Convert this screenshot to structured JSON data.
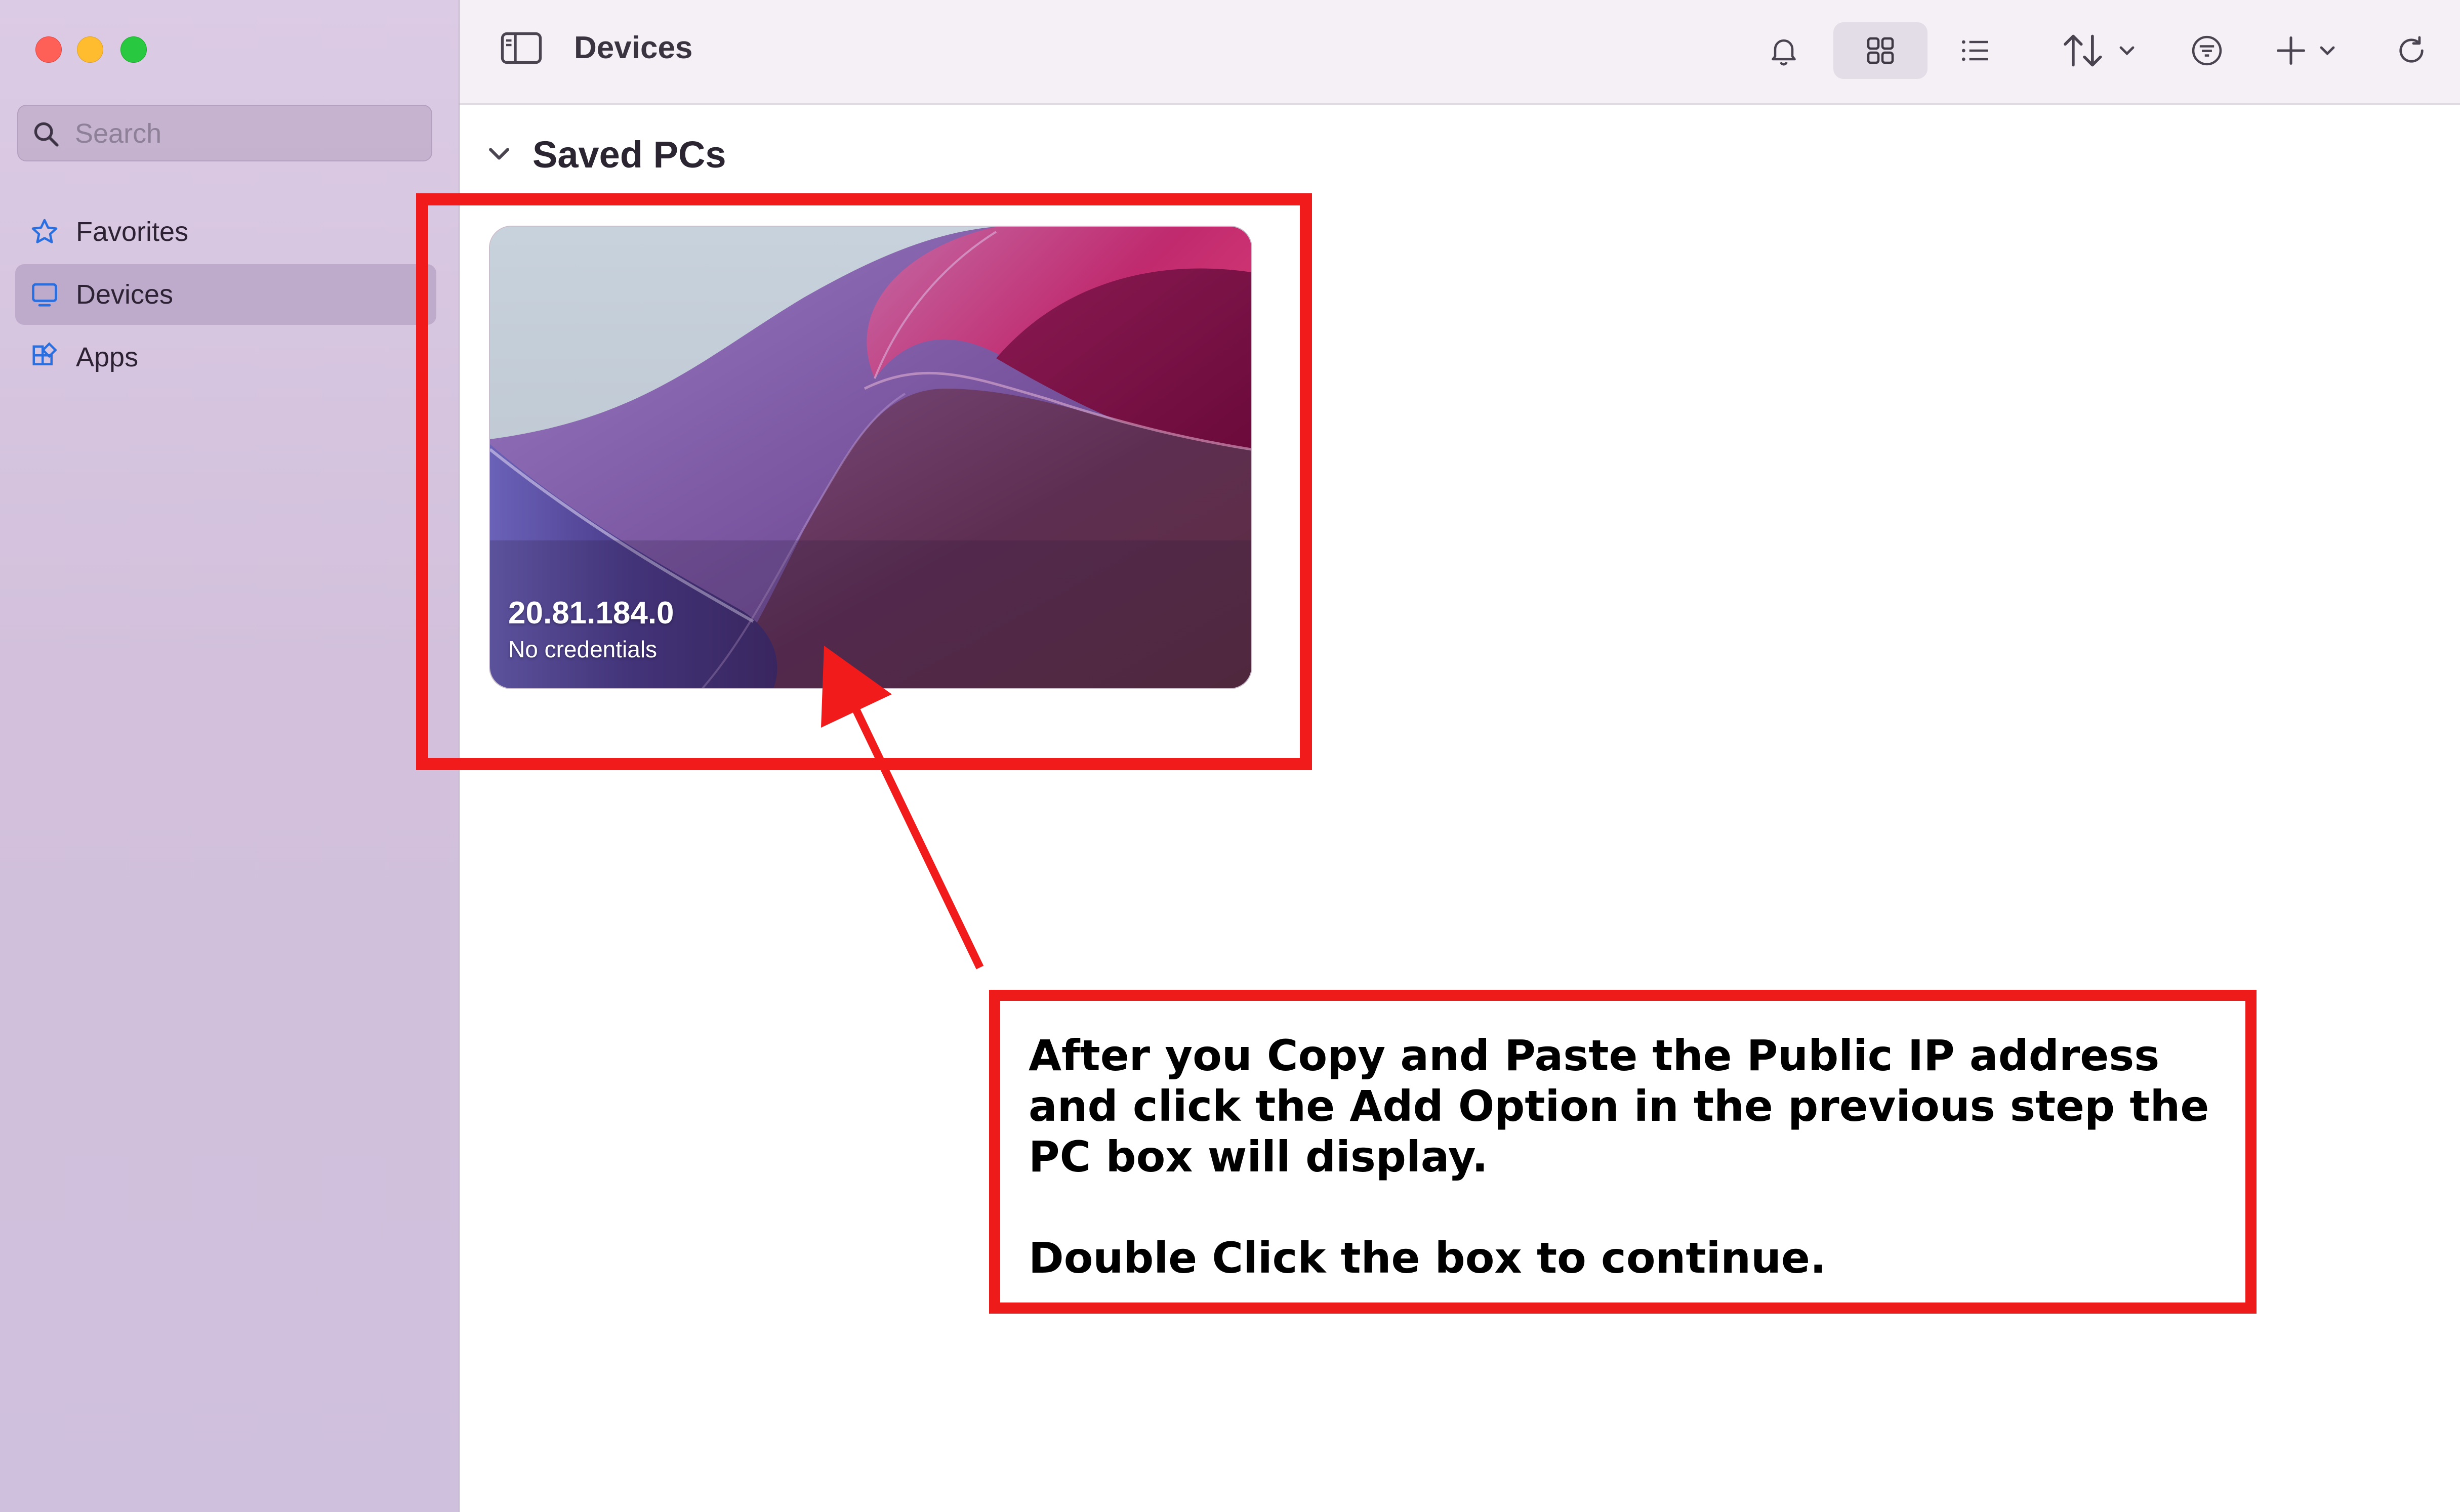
{
  "window": {
    "controls": [
      "close",
      "minimize",
      "zoom"
    ]
  },
  "sidebar": {
    "search_placeholder": "Search",
    "items": [
      {
        "label": "Favorites",
        "icon": "star-icon",
        "active": false
      },
      {
        "label": "Devices",
        "icon": "monitor-icon",
        "active": true
      },
      {
        "label": "Apps",
        "icon": "apps-grid-icon",
        "active": false
      }
    ]
  },
  "toolbar": {
    "title": "Devices",
    "icons": [
      "sidebar-toggle-icon",
      "bell-icon",
      "grid-view-icon",
      "list-view-icon",
      "sort-icon",
      "filter-icon",
      "add-icon",
      "refresh-icon"
    ],
    "selected_view": "grid"
  },
  "main": {
    "section_title": "Saved PCs",
    "pcs": [
      {
        "name": "20.81.184.0",
        "status": "No credentials"
      }
    ]
  },
  "annotation": {
    "line1": "After you Copy and Paste the Public IP address and click the Add Option in the previous step the PC box will display.",
    "line2": "Double Click the box to continue.",
    "color": "#f21b1b"
  },
  "colors": {
    "sidebar_bg": "#d4c3de",
    "toolbar_bg": "#f4f0f6",
    "accent_blue": "#2a6fe0",
    "annotation_red": "#f21b1b"
  }
}
